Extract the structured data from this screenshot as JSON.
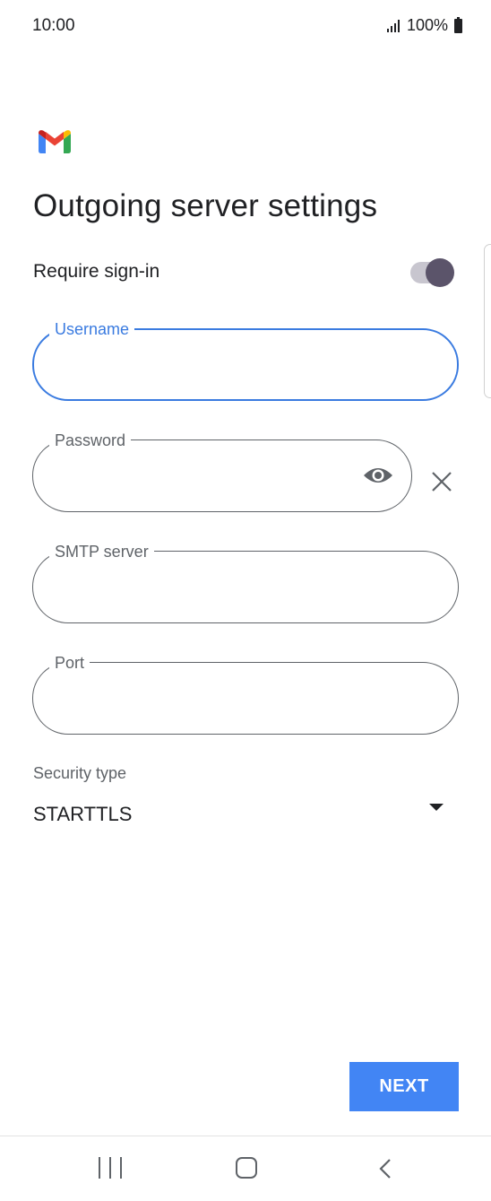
{
  "status_bar": {
    "time": "10:00",
    "battery": "100%"
  },
  "header": {
    "title": "Outgoing server settings"
  },
  "require_signin": {
    "label": "Require sign-in",
    "enabled": true
  },
  "fields": {
    "username": {
      "label": "Username",
      "value": ""
    },
    "password": {
      "label": "Password",
      "value": ""
    },
    "smtp_server": {
      "label": "SMTP server",
      "value": ""
    },
    "port": {
      "label": "Port",
      "value": ""
    }
  },
  "security": {
    "label": "Security type",
    "value": "STARTTLS"
  },
  "actions": {
    "next_label": "NEXT"
  },
  "colors": {
    "accent": "#3a7be0",
    "button": "#4285f4",
    "toggle_thumb": "#5b546a"
  },
  "icons": [
    "gmail-logo",
    "eye-icon",
    "close-icon",
    "dropdown-arrow-icon",
    "recents-icon",
    "home-icon",
    "back-icon"
  ]
}
